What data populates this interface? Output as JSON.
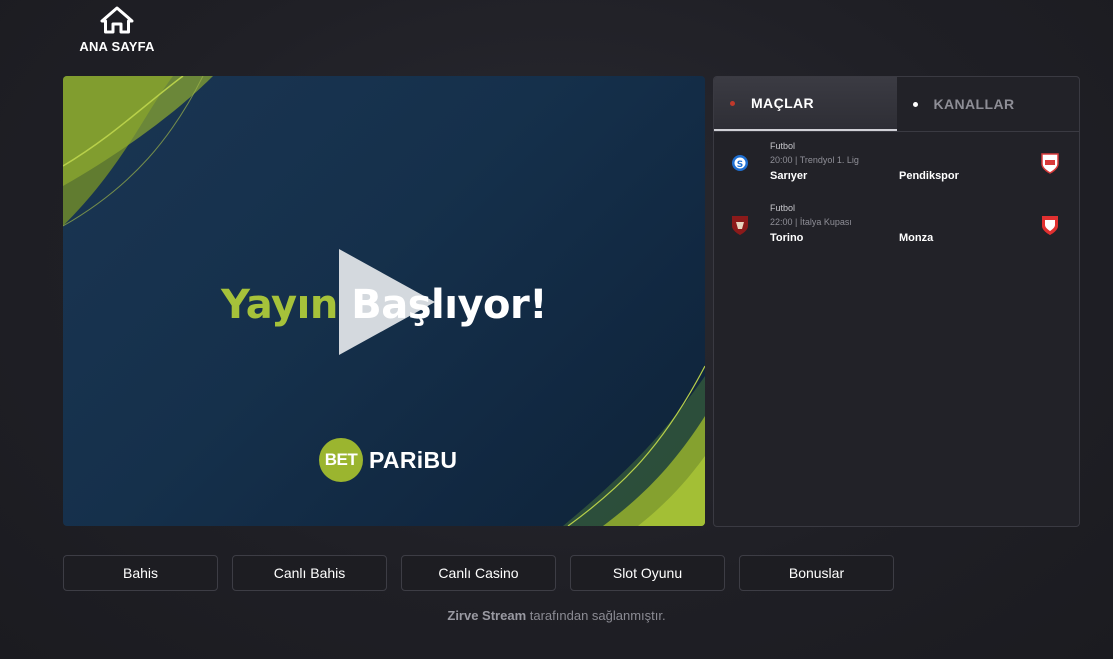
{
  "nav": {
    "home_label": "ANA SAYFA",
    "home_icon": "home-icon"
  },
  "player": {
    "headline_word1": "Yayın",
    "headline_word2": "Başlıyor!",
    "brand_mark": "BET",
    "brand_name": "PARiBU",
    "accent_color": "#a6c23a"
  },
  "panel": {
    "tabs": [
      {
        "label": "MAÇLAR",
        "active": true,
        "dot_color": "#c0392b"
      },
      {
        "label": "KANALLAR",
        "active": false,
        "dot_color": "#ffffff"
      }
    ],
    "matches": [
      {
        "sport": "Futbol",
        "meta": "20:00 | Trendyol 1. Lig",
        "home": "Sarıyer",
        "away": "Pendikspor"
      },
      {
        "sport": "Futbol",
        "meta": "22:00 | İtalya Kupası",
        "home": "Torino",
        "away": "Monza"
      }
    ]
  },
  "buttons": [
    "Bahis",
    "Canlı Bahis",
    "Canlı Casino",
    "Slot Oyunu",
    "Bonuslar"
  ],
  "footer": {
    "brand": "Zirve Stream",
    "text": " tarafından sağlanmıştır."
  }
}
